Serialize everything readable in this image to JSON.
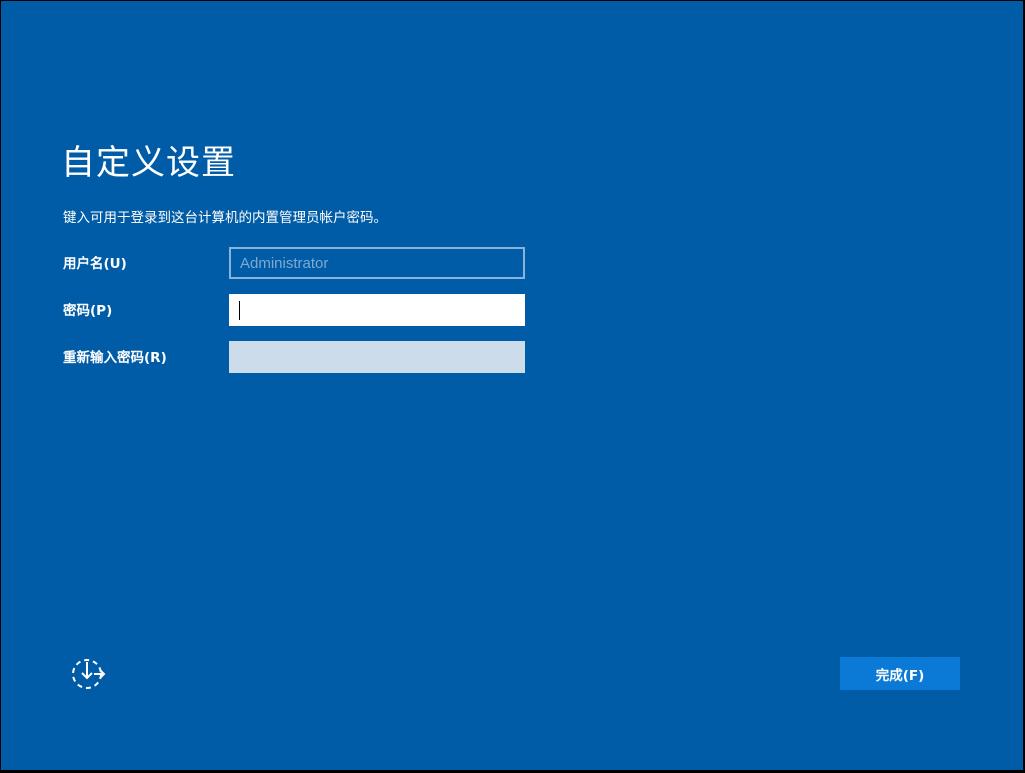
{
  "page": {
    "title": "自定义设置",
    "subtitle": "键入可用于登录到这台计算机的内置管理员帐户密码。"
  },
  "form": {
    "username": {
      "label": "用户名(U)",
      "value": "Administrator"
    },
    "password": {
      "label": "密码(P)",
      "value": ""
    },
    "reenter_password": {
      "label": "重新输入密码(R)",
      "value": ""
    }
  },
  "footer": {
    "accessibility_icon": "ease-of-access-icon",
    "finish_label": "完成(F)"
  },
  "colors": {
    "background": "#005ca7",
    "button": "#0a7ad6",
    "disabled_field": "#cddcea"
  }
}
